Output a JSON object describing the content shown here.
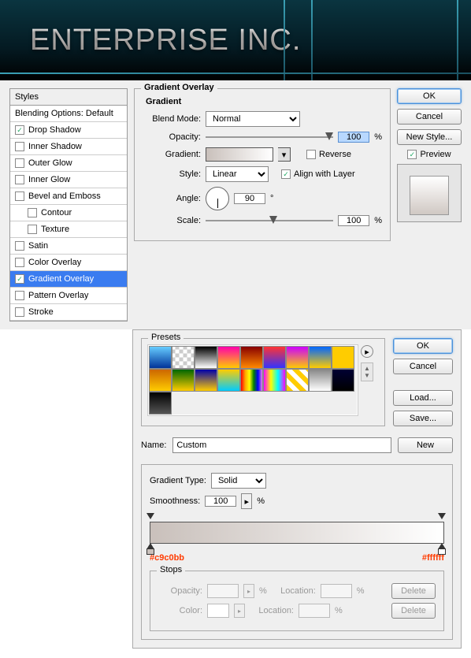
{
  "banner": {
    "title": "ENTERPRISE INC."
  },
  "styles_panel": {
    "header": "Styles",
    "blending": "Blending Options: Default",
    "items": [
      {
        "label": "Drop Shadow",
        "checked": true,
        "selected": false
      },
      {
        "label": "Inner Shadow",
        "checked": false,
        "selected": false
      },
      {
        "label": "Outer Glow",
        "checked": false,
        "selected": false
      },
      {
        "label": "Inner Glow",
        "checked": false,
        "selected": false
      },
      {
        "label": "Bevel and Emboss",
        "checked": false,
        "selected": false
      },
      {
        "label": "Contour",
        "checked": false,
        "selected": false,
        "sub": true
      },
      {
        "label": "Texture",
        "checked": false,
        "selected": false,
        "sub": true
      },
      {
        "label": "Satin",
        "checked": false,
        "selected": false
      },
      {
        "label": "Color Overlay",
        "checked": false,
        "selected": false
      },
      {
        "label": "Gradient Overlay",
        "checked": true,
        "selected": true
      },
      {
        "label": "Pattern Overlay",
        "checked": false,
        "selected": false
      },
      {
        "label": "Stroke",
        "checked": false,
        "selected": false
      }
    ]
  },
  "gradient_overlay": {
    "title": "Gradient Overlay",
    "subtitle": "Gradient",
    "blend_mode_label": "Blend Mode:",
    "blend_mode": "Normal",
    "opacity_label": "Opacity:",
    "opacity": "100",
    "pct": "%",
    "gradient_label": "Gradient:",
    "reverse_label": "Reverse",
    "reverse": false,
    "style_label": "Style:",
    "style": "Linear",
    "align_label": "Align with Layer",
    "align": true,
    "angle_label": "Angle:",
    "angle": "90",
    "deg": "°",
    "scale_label": "Scale:",
    "scale": "100"
  },
  "buttons": {
    "ok": "OK",
    "cancel": "Cancel",
    "new_style": "New Style...",
    "preview": "Preview",
    "load": "Load...",
    "save": "Save...",
    "new": "New",
    "delete": "Delete"
  },
  "editor": {
    "presets_label": "Presets",
    "name_label": "Name:",
    "name": "Custom",
    "grad_type_label": "Gradient Type:",
    "grad_type": "Solid",
    "smooth_label": "Smoothness:",
    "smooth": "100",
    "hex_left": "#c9c0bb",
    "hex_right": "#ffffff",
    "stops_label": "Stops",
    "opacity_label": "Opacity:",
    "location_label": "Location:",
    "color_label": "Color:",
    "preset_colors": [
      "linear-gradient(to bottom,#6cf,#039)",
      "repeating-conic-gradient(#ccc 0 25%,#fff 0 50%) 50%/10px 10px",
      "linear-gradient(#000,#fff)",
      "linear-gradient(#f0a,#fc0)",
      "linear-gradient(#800,#f80)",
      "linear-gradient(#f33,#33f)",
      "linear-gradient(#c0f,#fc0)",
      "linear-gradient(#06f,#fc0)",
      "linear-gradient(#fc0,#fc0)",
      "linear-gradient(#c60,#fc0)",
      "linear-gradient(#060,#fc0)",
      "linear-gradient(#00a,#fc0)",
      "linear-gradient(#fc0,#0cf)",
      "linear-gradient(to right,red,orange,yellow,green,blue,violet)",
      "linear-gradient(to right,#f0f,#ff0,#0ff,#f0f)",
      "repeating-linear-gradient(45deg,#fc0 0 6px,#fff 6px 12px)",
      "linear-gradient(#888,#fff)",
      "linear-gradient(#003,#000)",
      "linear-gradient(#000,#555)"
    ]
  }
}
